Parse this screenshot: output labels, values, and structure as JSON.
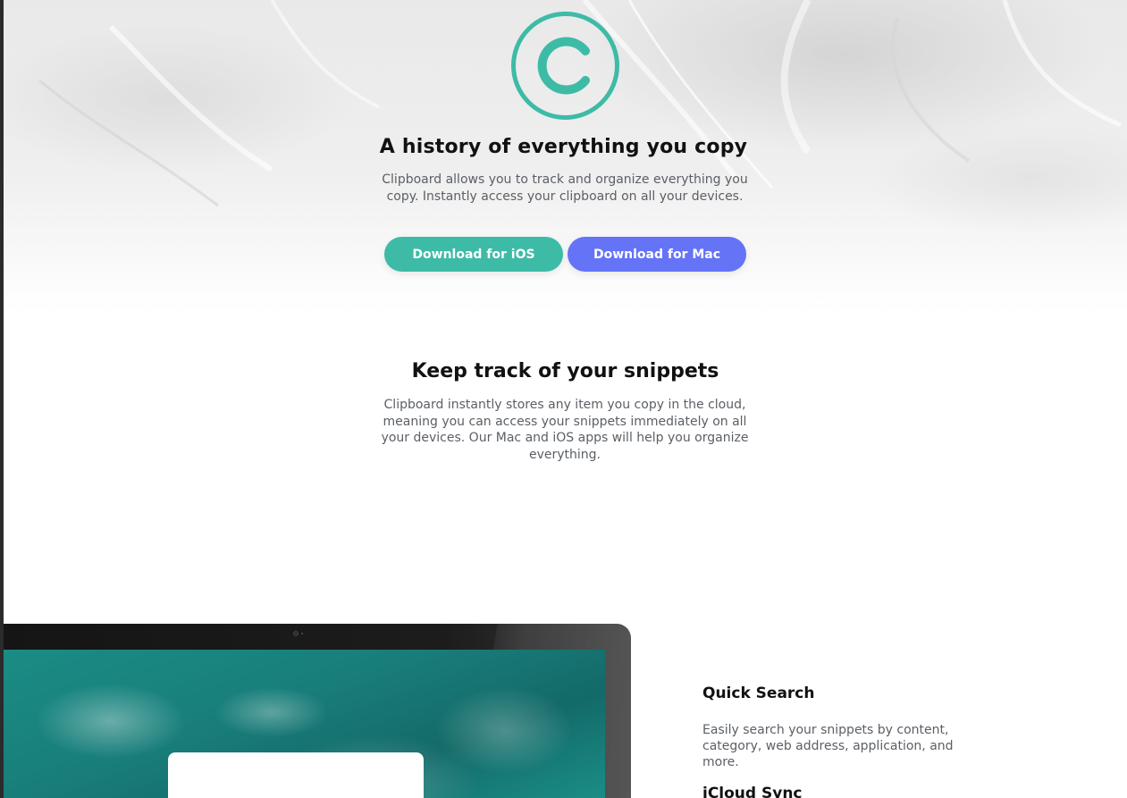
{
  "hero": {
    "title": "A history of everything you copy",
    "subtitle": "Clipboard allows you to track and organize everything you copy. Instantly access your clipboard on all your devices.",
    "buttons": {
      "ios_label": "Download for iOS",
      "mac_label": "Download for Mac"
    },
    "logo_icon": "clipboard-c-logo-icon"
  },
  "snippets": {
    "title": "Keep track of your snippets",
    "text": "Clipboard instantly stores any item you copy in the cloud, meaning you can access your snippets immediately on all your devices. Our Mac and iOS apps will help you organize everything."
  },
  "features": [
    {
      "title": "Quick Search",
      "text": "Easily search your snippets by content, category, web address, application, and more."
    },
    {
      "title": "iCloud Sync",
      "text": ""
    }
  ],
  "colors": {
    "accent_teal": "#3dbba6",
    "accent_blue": "#6573f7",
    "heading": "#111111",
    "body_text": "#5a5f66"
  }
}
